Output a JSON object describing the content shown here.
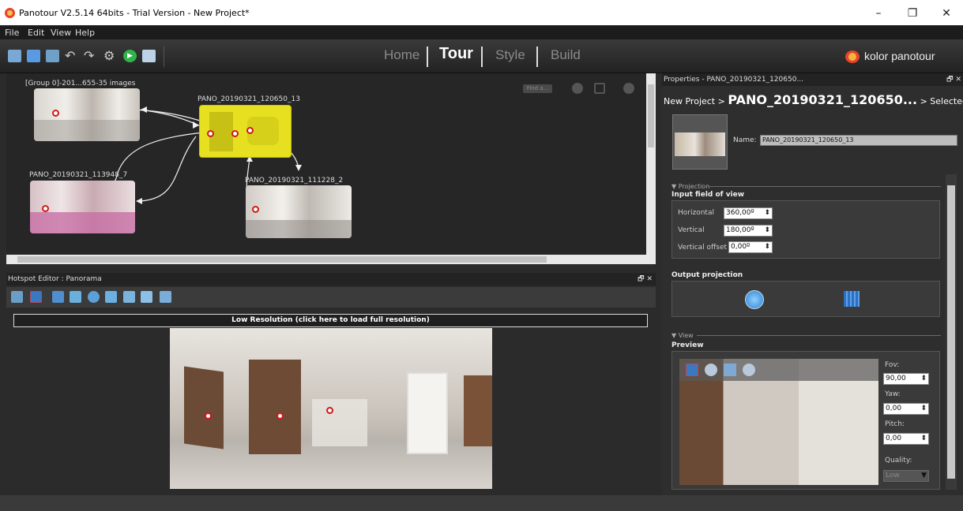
{
  "window": {
    "title": "Panotour V2.5.14 64bits - Trial Version - New Project*",
    "minimize": "–",
    "restore": "❐",
    "close": "✕"
  },
  "menu": [
    "File",
    "Edit",
    "View",
    "Help"
  ],
  "toolbar": {
    "modes": [
      "Home",
      "Tour",
      "Style",
      "Build"
    ],
    "active_mode": "Tour",
    "brand": "kolor panotour",
    "icons": [
      "add-panoramas-icon",
      "save-icon",
      "add-images-icon",
      "undo-icon",
      "redo-icon",
      "settings-icon",
      "play-icon",
      "folder-icon"
    ]
  },
  "graph": {
    "find_placeholder": "Find a...",
    "nodes": [
      {
        "label": "[Group 0]-201...655-35 images"
      },
      {
        "label": "PANO_20190321_120650_13"
      },
      {
        "label": "PANO_20190321_113948_7"
      },
      {
        "label": "PANO_20190321_111228_2"
      }
    ]
  },
  "hotspot_editor": {
    "title": "Hotspot Editor : Panorama",
    "float_close": "🗗 ✕",
    "low_res_banner": "Low Resolution (click here to load full resolution)"
  },
  "properties": {
    "title": "Properties - PANO_20190321_120650...",
    "float_close": "🗗 ✕",
    "breadcrumb_prefix": "New Project >",
    "breadcrumb_current": "PANO_20190321_120650...",
    "breadcrumb_suffix": "> Selected spots",
    "name_label": "Name:",
    "name_value": "PANO_20190321_120650_13",
    "projection_section": "Projection",
    "input_fov_title": "Input field of view",
    "horizontal_label": "Horizontal",
    "horizontal_value": "360,00º",
    "vertical_label": "Vertical",
    "vertical_value": "180,00º",
    "vertical_offset_label": "Vertical offset",
    "vertical_offset_value": "0,00º",
    "output_projection_title": "Output projection",
    "view_section": "View",
    "preview_title": "Preview",
    "fov_label": "Fov:",
    "fov_value": "90,00",
    "yaw_label": "Yaw:",
    "yaw_value": "0,00",
    "pitch_label": "Pitch:",
    "pitch_value": "0,00",
    "quality_label": "Quality:",
    "quality_value": "Low"
  },
  "colors": {
    "accent": "#f5a623",
    "selected_node": "#e6e020",
    "hotspot": "#d01818"
  }
}
